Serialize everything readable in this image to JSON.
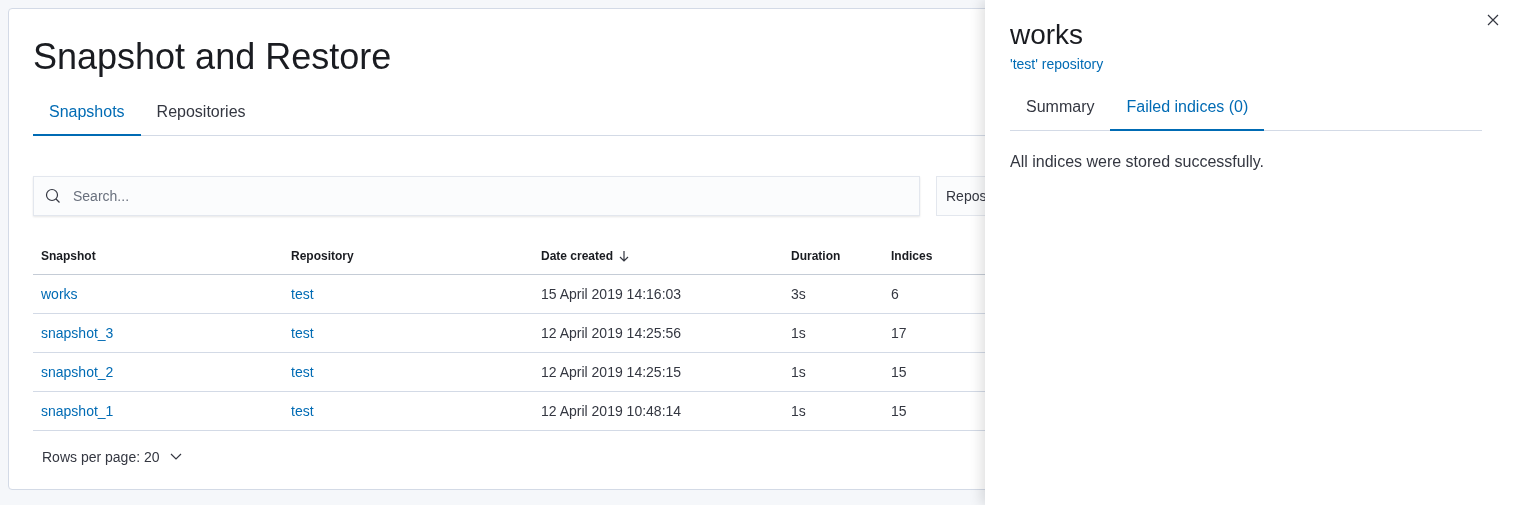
{
  "page": {
    "title": "Snapshot and Restore"
  },
  "tabs": [
    {
      "label": "Snapshots",
      "selected": true
    },
    {
      "label": "Repositories",
      "selected": false
    }
  ],
  "search": {
    "placeholder": "Search..."
  },
  "repository_filter": {
    "label": "Repos"
  },
  "table": {
    "columns": [
      {
        "label": "Snapshot",
        "sorted": false
      },
      {
        "label": "Repository",
        "sorted": false
      },
      {
        "label": "Date created",
        "sorted": true
      },
      {
        "label": "Duration",
        "sorted": false
      },
      {
        "label": "Indices",
        "sorted": false
      }
    ],
    "rows": [
      {
        "snapshot": "works",
        "repository": "test",
        "date_created": "15 April 2019 14:16:03",
        "duration": "3s",
        "indices": "6"
      },
      {
        "snapshot": "snapshot_3",
        "repository": "test",
        "date_created": "12 April 2019 14:25:56",
        "duration": "1s",
        "indices": "17"
      },
      {
        "snapshot": "snapshot_2",
        "repository": "test",
        "date_created": "12 April 2019 14:25:15",
        "duration": "1s",
        "indices": "15"
      },
      {
        "snapshot": "snapshot_1",
        "repository": "test",
        "date_created": "12 April 2019 10:48:14",
        "duration": "1s",
        "indices": "15"
      }
    ]
  },
  "pagination": {
    "rows_per_page": "Rows per page: 20"
  },
  "flyout": {
    "title": "works",
    "subtitle": "'test' repository",
    "tabs": [
      {
        "label": "Summary",
        "selected": false
      },
      {
        "label": "Failed indices (0)",
        "selected": true
      }
    ],
    "message": "All indices were stored successfully."
  }
}
